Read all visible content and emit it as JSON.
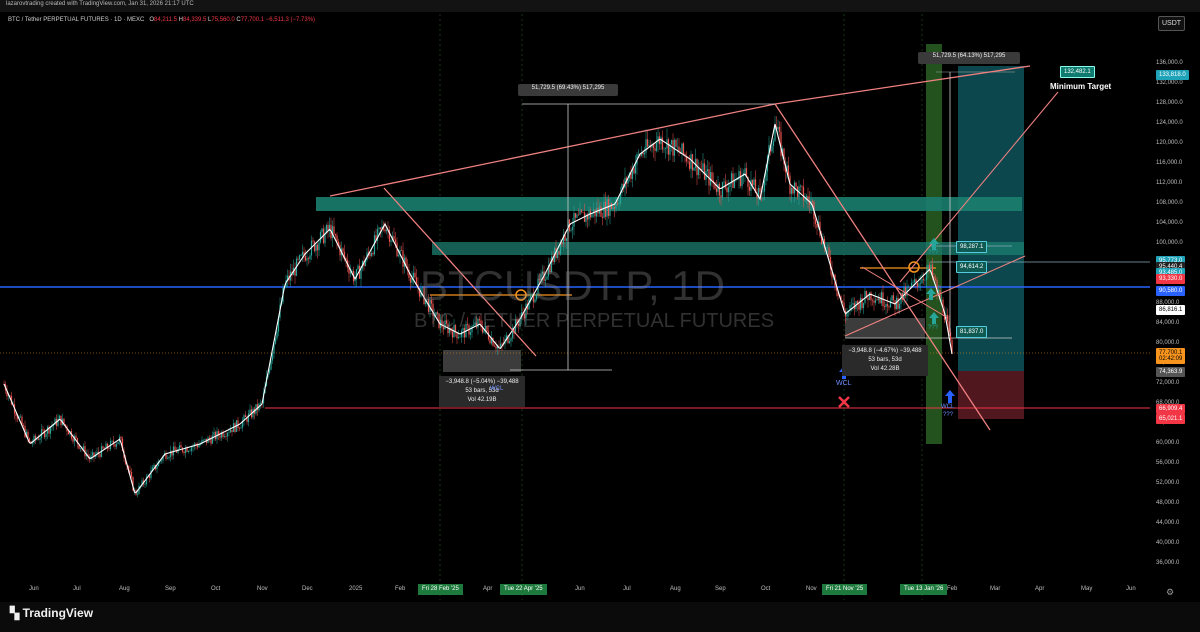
{
  "credit": "lazarovtrading created with TradingView.com, Jan 31, 2026 21:17 UTC",
  "header": {
    "symbol": "BTC / Tether PERPETUAL FUTURES · 1D · MEXC",
    "o_label": "O",
    "o": "84,211.5",
    "h_label": "H",
    "h": "84,339.5",
    "l_label": "L",
    "l": "75,560.0",
    "c_label": "C",
    "c": "77,700.1",
    "change": "−6,511.3 (−7.73%)"
  },
  "currency_button": "USDT",
  "watermark": {
    "ticker": "BTCUSDT.P, 1D",
    "name": "BTC / TETHER PERPETUAL FUTURES"
  },
  "colors": {
    "candle_up": "#26a69a",
    "candle_down": "#ef5350",
    "ma": "#ffffff",
    "trendline": "#f08080",
    "zone": "#1b7e6f",
    "blue_line": "#2962ff",
    "red_line": "#f23645",
    "target_box": "#0d4f55",
    "stop_box": "#5a1a22",
    "highlight_column": "#2f6e2a"
  },
  "y_axis": {
    "ticks": [
      "136,000.0",
      "132,000.0",
      "128,000.0",
      "124,000.0",
      "120,000.0",
      "116,000.0",
      "112,000.0",
      "108,000.0",
      "104,000.0",
      "100,000.0",
      "96,000.0",
      "92,000.0",
      "88,000.0",
      "84,000.0",
      "80,000.0",
      "76,000.0",
      "72,000.0",
      "68,000.0",
      "64,000.0",
      "60,000.0",
      "56,000.0",
      "52,000.0",
      "48,000.0",
      "44,000.0",
      "40,000.0",
      "36,000.0"
    ]
  },
  "price_tags": [
    {
      "text": "133,818.0",
      "bg": "#1fa3b8",
      "fg": "#ffffff",
      "price": 133818
    },
    {
      "text": "95,773.0",
      "bg": "#1fa3b8",
      "fg": "#ffffff",
      "price": 96650
    },
    {
      "text": "95,440.4",
      "bg": "#222222",
      "fg": "#ffffff",
      "price": 95440
    },
    {
      "text": "93,485.0",
      "bg": "#1fa3b8",
      "fg": "#ffffff",
      "price": 94200
    },
    {
      "text": "93,330.0",
      "bg": "#f23645",
      "fg": "#ffffff",
      "price": 93000
    },
    {
      "text": "90,580.0",
      "bg": "#2962ff",
      "fg": "#ffffff",
      "price": 90580
    },
    {
      "text": "86,816.1",
      "bg": "#ffffff",
      "fg": "#000000",
      "price": 86816
    },
    {
      "text": "77,700.1",
      "bg": "#f7941d",
      "fg": "#000000",
      "price": 78300
    },
    {
      "text": "02:42:09",
      "bg": "#f7941d",
      "fg": "#000000",
      "price": 77000
    },
    {
      "text": "74,363.9",
      "bg": "#555555",
      "fg": "#ffffff",
      "price": 74364
    },
    {
      "text": "66,909.4",
      "bg": "#f23645",
      "fg": "#ffffff",
      "price": 66909
    },
    {
      "text": "65,021.1",
      "bg": "#f23645",
      "fg": "#ffffff",
      "price": 65021
    }
  ],
  "x_axis": {
    "ticks": [
      {
        "label": "Jun",
        "x": 34
      },
      {
        "label": "Jul",
        "x": 78
      },
      {
        "label": "Aug",
        "x": 124
      },
      {
        "label": "Sep",
        "x": 170
      },
      {
        "label": "Oct",
        "x": 216
      },
      {
        "label": "Nov",
        "x": 262
      },
      {
        "label": "Dec",
        "x": 307
      },
      {
        "label": "2025",
        "x": 354
      },
      {
        "label": "Feb",
        "x": 400
      },
      {
        "label": "Apr",
        "x": 488
      },
      {
        "label": "Jun",
        "x": 580
      },
      {
        "label": "Jul",
        "x": 628
      },
      {
        "label": "Aug",
        "x": 675
      },
      {
        "label": "Sep",
        "x": 720
      },
      {
        "label": "Oct",
        "x": 766
      },
      {
        "label": "Nov",
        "x": 811
      },
      {
        "label": "Feb",
        "x": 952
      },
      {
        "label": "Mar",
        "x": 995
      },
      {
        "label": "Apr",
        "x": 1040
      },
      {
        "label": "May",
        "x": 1086
      },
      {
        "label": "Jun",
        "x": 1131
      }
    ],
    "highlights": [
      {
        "label": "Fri 28 Feb '25",
        "x": 440
      },
      {
        "label": "Tue 22 Apr '25",
        "x": 522
      },
      {
        "label": "Fri 21 Nov '25",
        "x": 844
      },
      {
        "label": "Tue 13 Jan '26",
        "x": 922
      }
    ]
  },
  "annotations": {
    "measure_top": "51,729.5 (69.43%) 517,295",
    "measure_right": "51,729.5 (64.13%) 517,295",
    "target_price": "132,482.1",
    "minimum_target": "Minimum Target",
    "levels": [
      "98,287.1",
      "94,614.2",
      "81,837.0"
    ],
    "stat_left": [
      "−3,948.8 (−5.04%) −39,488",
      "53 bars, 53d",
      "Vol 42.19B"
    ],
    "stat_right": [
      "−3,948.8 (−4.67%) −39,488",
      "53 bars, 53d",
      "Vol 42.28B"
    ],
    "wcl": "WCL",
    "qmarks": "???"
  },
  "chart_data": {
    "type": "candlestick",
    "title": "BTC / Tether PERPETUAL FUTURES · 1D · MEXC",
    "ylim": [
      34000,
      140000
    ],
    "y_scale": "linear",
    "x_range": [
      "2024-05",
      "2026-06"
    ],
    "series": [
      {
        "name": "BTCUSDT.P",
        "points": [
          [
            "2024-06-01",
            68000
          ],
          [
            "2024-07-01",
            62000
          ],
          [
            "2024-08-01",
            58000
          ],
          [
            "2024-09-01",
            57000
          ],
          [
            "2024-10-01",
            62000
          ],
          [
            "2024-11-01",
            69000
          ],
          [
            "2024-12-01",
            97000
          ],
          [
            "2025-01-01",
            94000
          ],
          [
            "2025-02-01",
            100000
          ],
          [
            "2025-03-01",
            84000
          ],
          [
            "2025-04-01",
            82000
          ],
          [
            "2025-05-01",
            96000
          ],
          [
            "2025-06-01",
            105000
          ],
          [
            "2025-07-01",
            116000
          ],
          [
            "2025-08-01",
            115000
          ],
          [
            "2025-09-01",
            110000
          ],
          [
            "2025-10-01",
            120000
          ],
          [
            "2025-11-01",
            104000
          ],
          [
            "2025-12-01",
            88000
          ],
          [
            "2026-01-01",
            92000
          ],
          [
            "2026-01-31",
            77700
          ]
        ]
      }
    ],
    "levels": {
      "blue_support": 90580,
      "red_support": 66909,
      "green_zone_1": [
        105500,
        108000
      ],
      "green_zone_2": [
        94600,
        97000
      ],
      "target": 133818
    }
  }
}
